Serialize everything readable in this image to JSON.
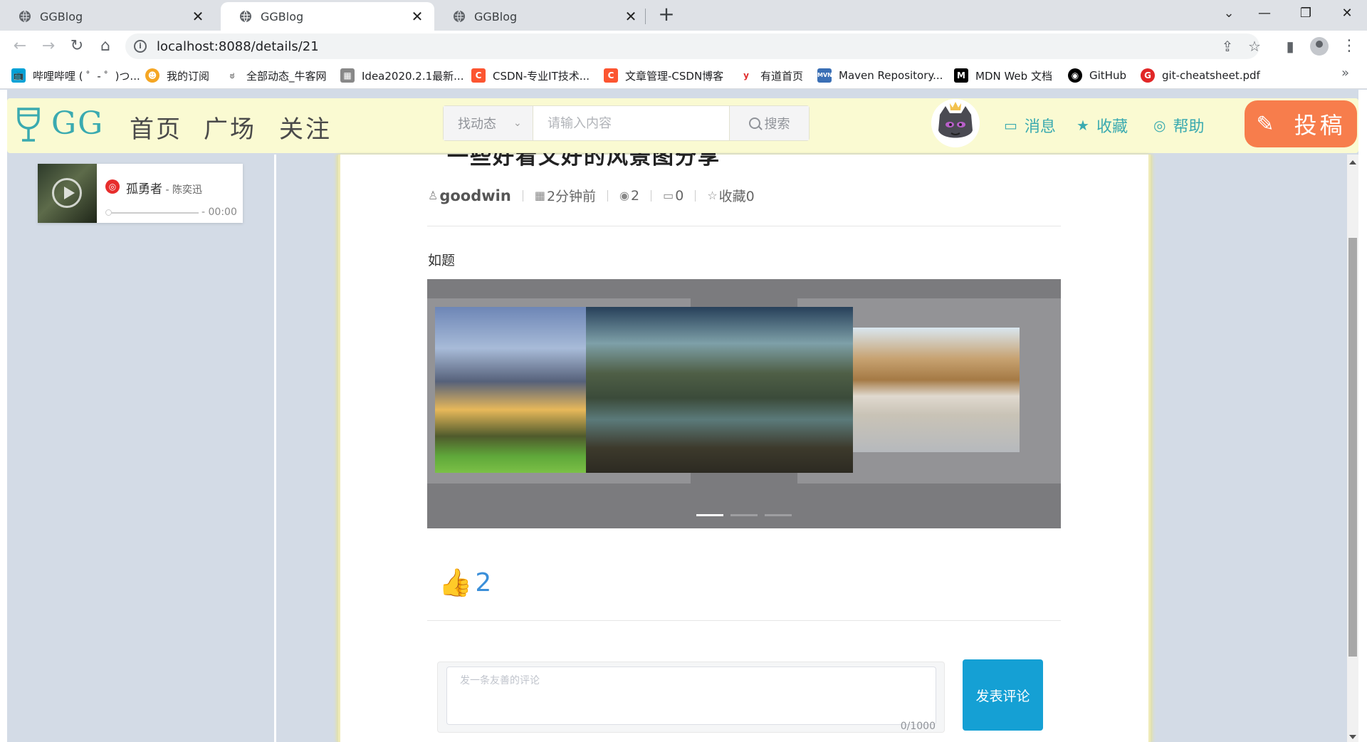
{
  "browser": {
    "tabs": [
      {
        "title": "GGBlog"
      },
      {
        "title": "GGBlog"
      },
      {
        "title": "GGBlog"
      }
    ],
    "url": "localhost:8088/details/21",
    "bookmarks": [
      {
        "label": "哔哩哔哩 ( ゜- ゜)つ...",
        "icon": "bilibili-icon",
        "color": "#00a1d6"
      },
      {
        "label": "我的订阅",
        "icon": "subscription-icon",
        "color": "#f5a623"
      },
      {
        "label": "全部动态_牛客网",
        "icon": "nowcoder-icon",
        "color": "#7a7a7a"
      },
      {
        "label": "Idea2020.2.1最新...",
        "icon": "idea-icon",
        "color": "#888888"
      },
      {
        "label": "CSDN-专业IT技术...",
        "icon": "csdn-icon",
        "color": "#fc5531"
      },
      {
        "label": "文章管理-CSDN博客",
        "icon": "csdn-icon",
        "color": "#fc5531"
      },
      {
        "label": "有道首页",
        "icon": "youdao-icon",
        "color": "#e02f2f"
      },
      {
        "label": "Maven Repository...",
        "icon": "maven-icon",
        "color": "#3a6fb5"
      },
      {
        "label": "MDN Web 文档",
        "icon": "mdn-icon",
        "color": "#000000"
      },
      {
        "label": "GitHub",
        "icon": "github-icon",
        "color": "#000000"
      },
      {
        "label": "git-cheatsheet.pdf",
        "icon": "pdf-icon",
        "color": "#e12727"
      }
    ]
  },
  "site": {
    "logo": "GG",
    "nav": [
      "首页",
      "广场",
      "关注"
    ],
    "search": {
      "select": "找动态",
      "placeholder": "请输入内容",
      "button": "搜索"
    },
    "header_links": [
      {
        "label": "消息",
        "icon": "message-icon"
      },
      {
        "label": "收藏",
        "icon": "star-icon"
      },
      {
        "label": "帮助",
        "icon": "help-icon"
      }
    ],
    "submit": "投稿",
    "brand_color": "#3aaab0",
    "submit_color": "#f77d4c"
  },
  "music": {
    "song": "孤勇者",
    "artist": " - 陈奕迅",
    "time": "- 00:00"
  },
  "article": {
    "title": "一些好看又好的风景图分享",
    "author": "goodwin",
    "time": "2分钟前",
    "views": "2",
    "comments": "0",
    "favorites": "收藏0",
    "content": "如题",
    "carousel": {
      "slides": 3,
      "active_index": 0
    },
    "likes": "2"
  },
  "comment": {
    "placeholder": "发一条友善的评论",
    "word_count": "0/1000",
    "button": "发表评论"
  }
}
